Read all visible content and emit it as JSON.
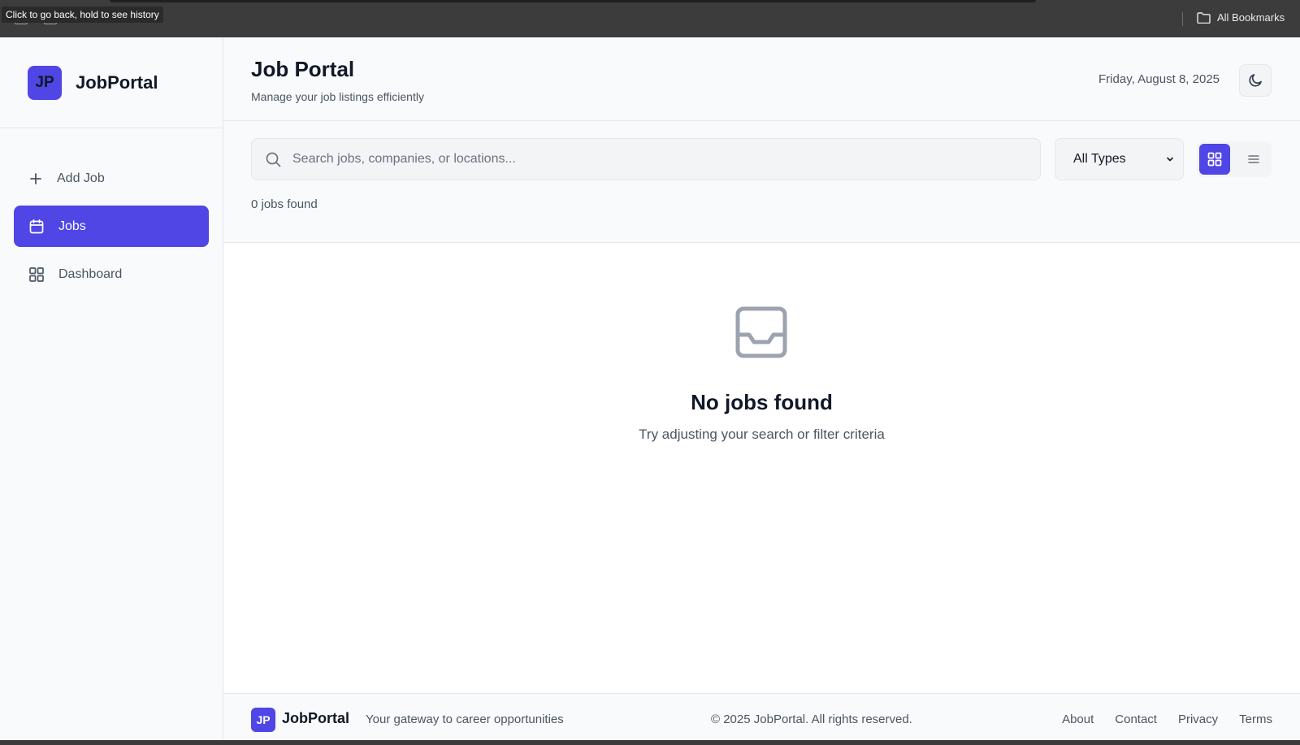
{
  "browser": {
    "tooltip": "Click to go back, hold to see history",
    "bookmarks_label": "All Bookmarks",
    "bookmarks_icon": "folder-icon"
  },
  "sidebar": {
    "logo_text": "JP",
    "brand_name": "JobPortal",
    "items": [
      {
        "label": "Add Job",
        "icon": "plus-icon",
        "active": false
      },
      {
        "label": "Jobs",
        "icon": "calendar-icon",
        "active": true
      },
      {
        "label": "Dashboard",
        "icon": "grid-icon",
        "active": false
      }
    ]
  },
  "header": {
    "title": "Job Portal",
    "subtitle": "Manage your job listings efficiently",
    "date": "Friday, August 8, 2025",
    "theme_icon": "moon-icon"
  },
  "toolbar": {
    "search_placeholder": "Search jobs, companies, or locations...",
    "search_value": "",
    "type_filter": "All Types",
    "view_modes": [
      "grid",
      "list"
    ],
    "active_view": "grid",
    "result_count": "0 jobs found"
  },
  "empty_state": {
    "icon": "inbox-icon",
    "title": "No jobs found",
    "message": "Try adjusting your search or filter criteria"
  },
  "footer": {
    "logo_text": "JP",
    "brand_name": "JobPortal",
    "tagline": "Your gateway to career opportunities",
    "copyright": "© 2025 JobPortal. All rights reserved.",
    "links": [
      "About",
      "Contact",
      "Privacy",
      "Terms"
    ]
  },
  "colors": {
    "accent": "#4f46e5",
    "background": "#f9fafb",
    "text_primary": "#111827",
    "text_secondary": "#4b5563"
  }
}
